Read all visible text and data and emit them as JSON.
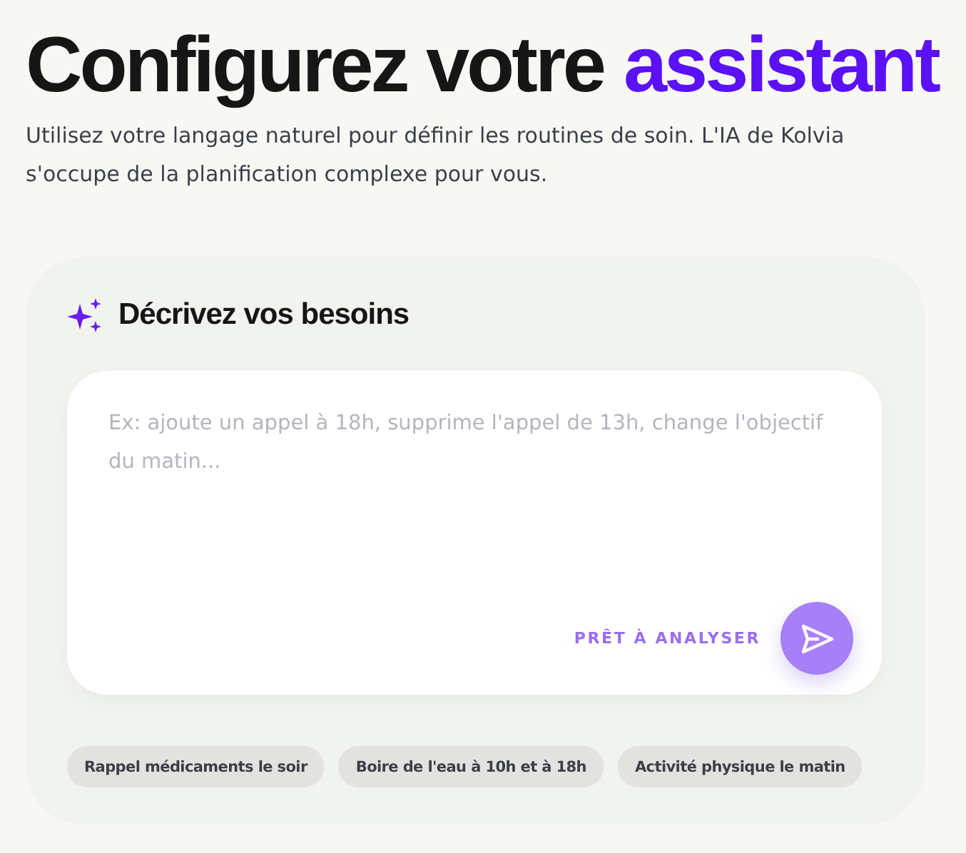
{
  "header": {
    "title": "Configurez votre",
    "title_highlight": "assistant",
    "subtitle": "Utilisez votre langage naturel pour définir les routines de soin. L'IA de Kolvia s'occupe de la planification complexe pour vous."
  },
  "card": {
    "heading": "Décrivez vos besoins",
    "input": {
      "placeholder": "Ex: ajoute un appel à 18h, supprime l'appel de 13h, change l'objectif du matin..."
    },
    "status": "PRÊT À ANALYSER",
    "suggestions": [
      "Rappel médicaments le soir",
      "Boire de l'eau à 10h et à 18h",
      "Activité physique le matin"
    ]
  }
}
